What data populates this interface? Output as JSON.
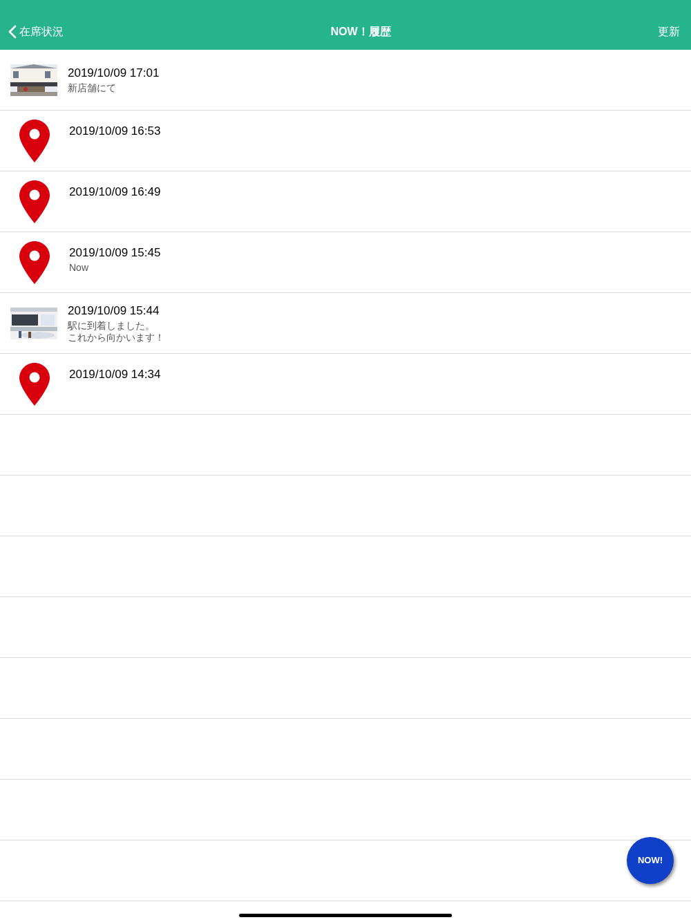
{
  "header": {
    "back_label": "在席状況",
    "title": "NOW！履歴",
    "action": "更新"
  },
  "entries": [
    {
      "time": "2019/10/09 17:01",
      "note_lines": [
        "新店舗にて"
      ]
    },
    {
      "kind": "pin",
      "time": "2019/10/09 16:53"
    },
    {
      "kind": "pin",
      "time": "2019/10/09 16:49"
    },
    {
      "kind": "pin",
      "time": "2019/10/09 15:45",
      "note_lines": [
        "Now"
      ]
    },
    {
      "time": "2019/10/09 15:44",
      "note_lines": [
        "駅に到着しました。",
        "これから向かいます！"
      ]
    },
    {
      "kind": "pin",
      "time": "2019/10/09 14:34"
    }
  ],
  "fab": {
    "label": "NOW!"
  }
}
